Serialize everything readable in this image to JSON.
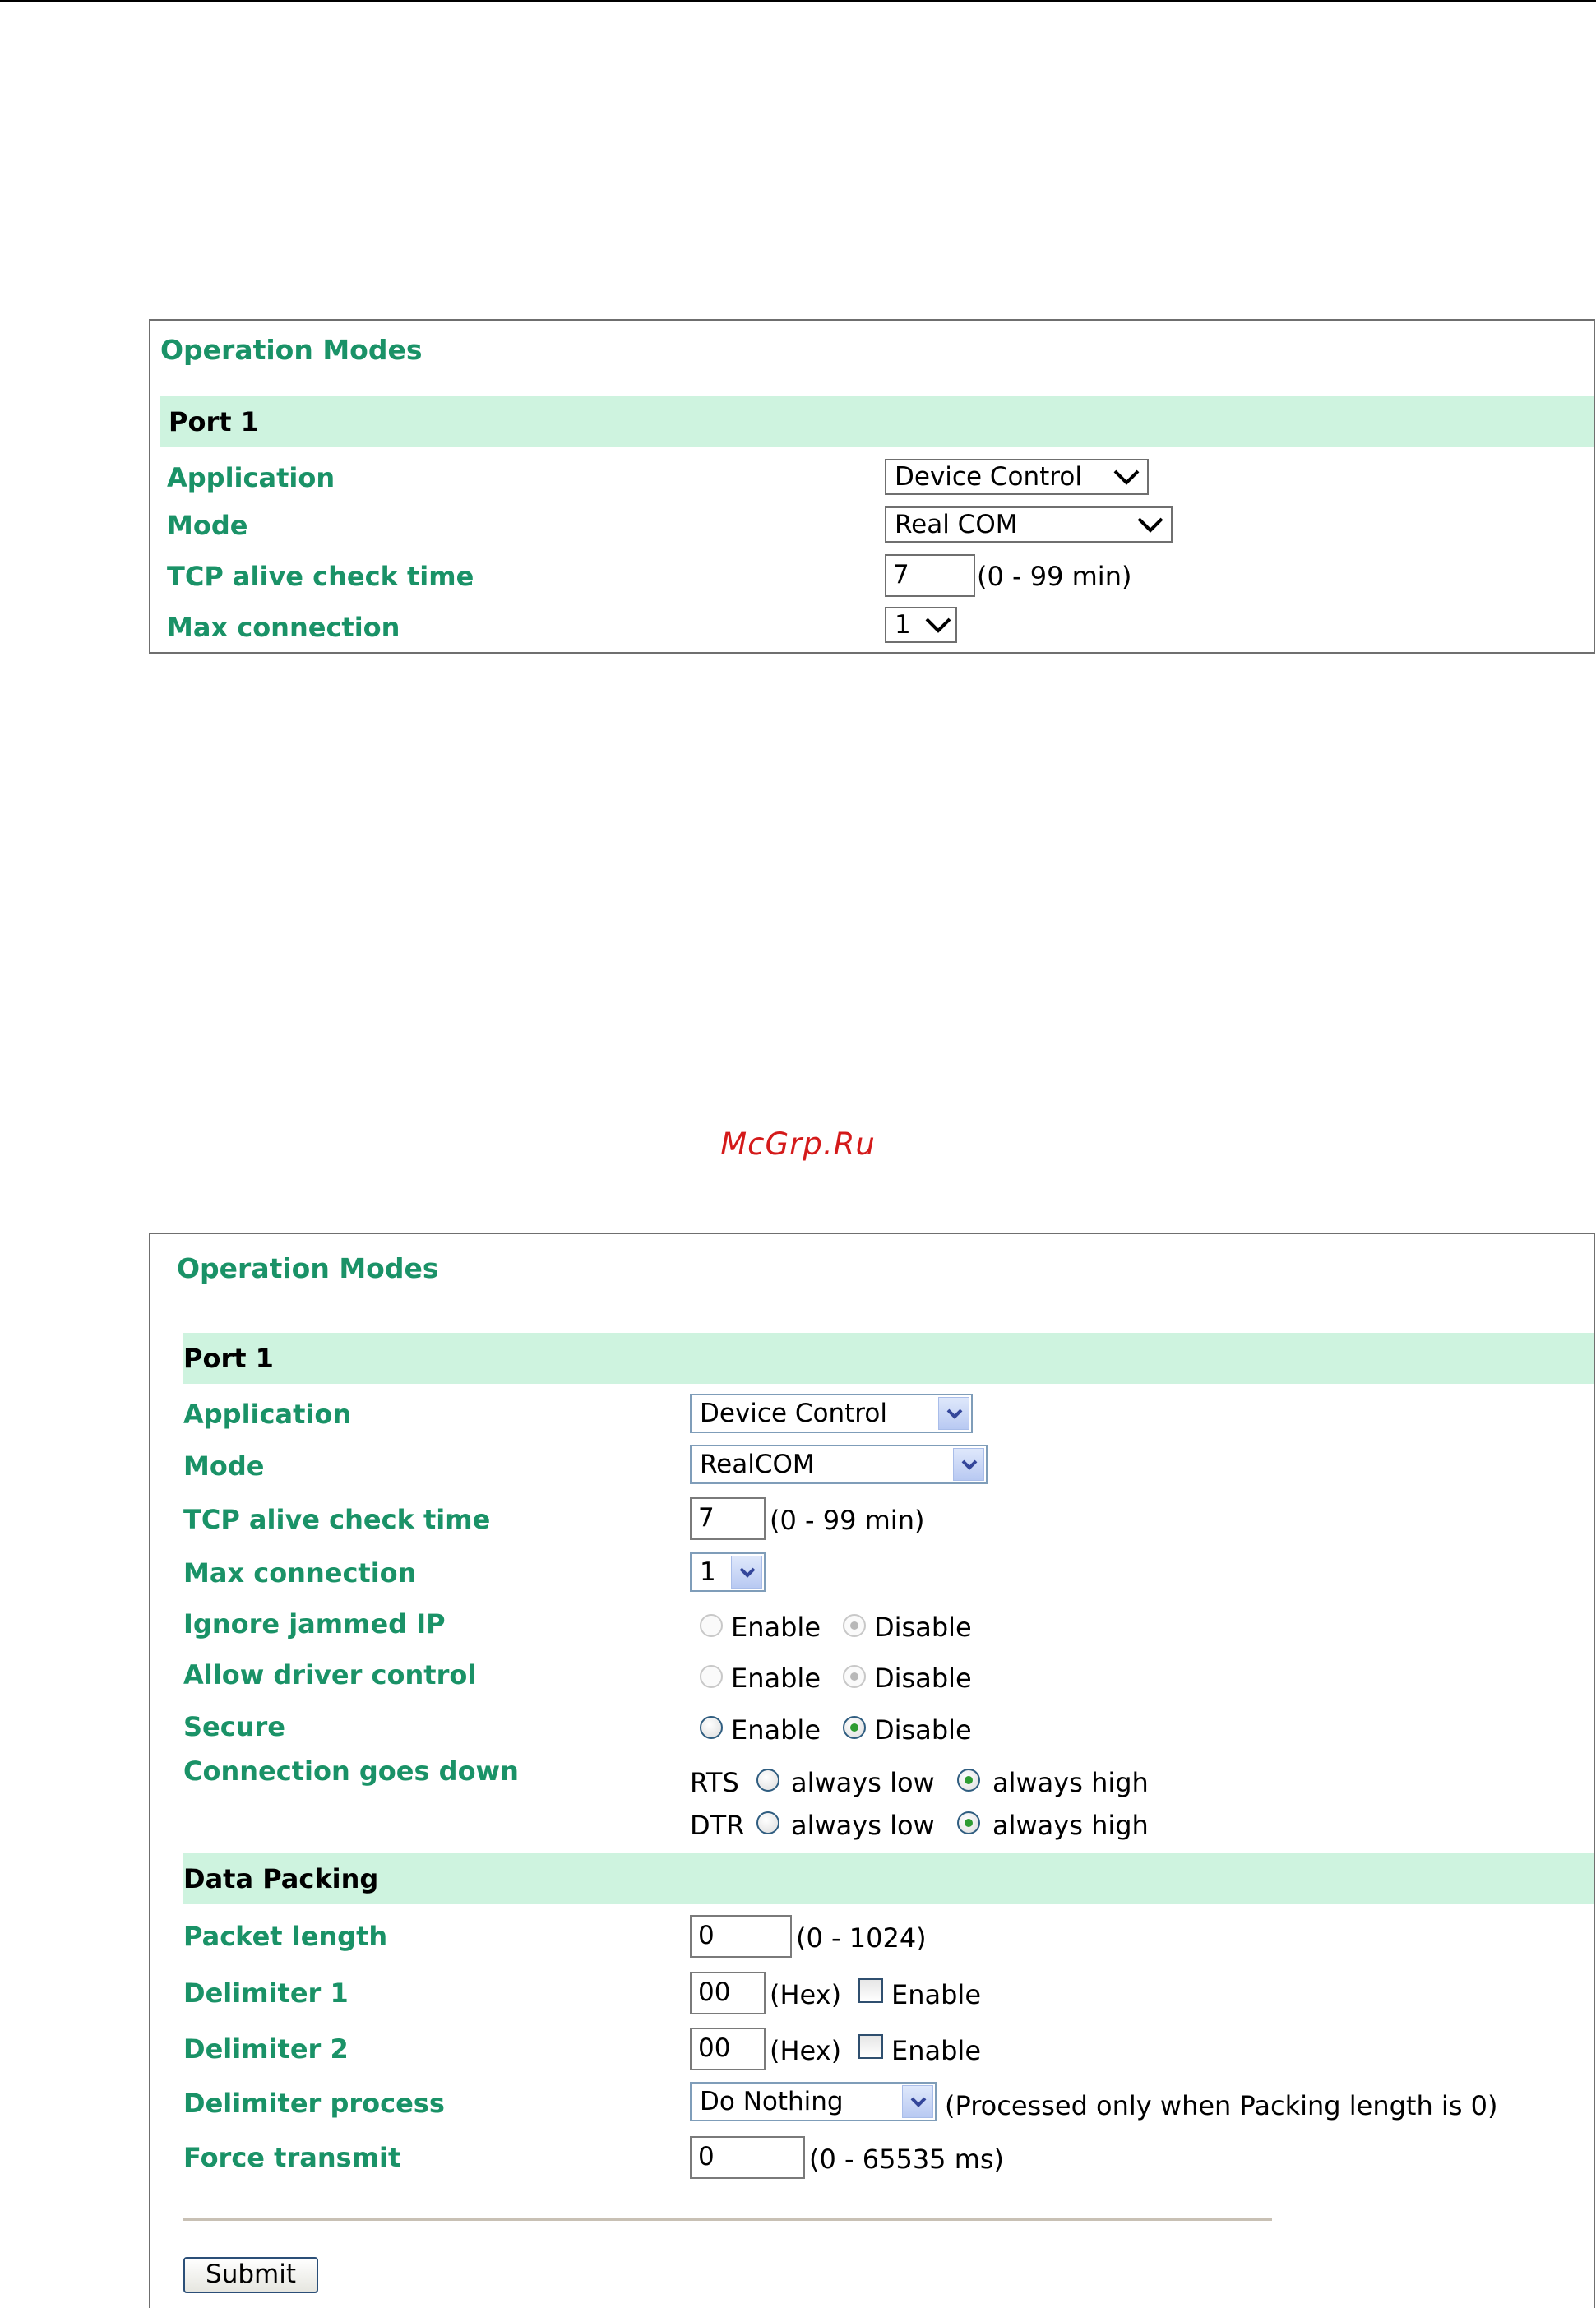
{
  "watermark": "McGrp.Ru",
  "panel1": {
    "title": "Operation Modes",
    "section": "Port 1",
    "rows": {
      "application_label": "Application",
      "application_value": "Device Control",
      "mode_label": "Mode",
      "mode_value": "Real COM",
      "tcp_label": "TCP alive check time",
      "tcp_value": "7",
      "tcp_range": "(0 - 99 min)",
      "maxconn_label": "Max connection",
      "maxconn_value": "1"
    }
  },
  "panel2": {
    "title": "Operation Modes",
    "section_port": "Port 1",
    "application_label": "Application",
    "application_value": "Device Control",
    "mode_label": "Mode",
    "mode_value": "RealCOM",
    "tcp_label": "TCP alive check time",
    "tcp_value": "7",
    "tcp_range": "(0 - 99 min)",
    "maxconn_label": "Max connection",
    "maxconn_value": "1",
    "ignore_label": "Ignore jammed IP",
    "allow_label": "Allow driver control",
    "secure_label": "Secure",
    "enable": "Enable",
    "disable": "Disable",
    "conn_label": "Connection goes down",
    "rts": "RTS",
    "dtr": "DTR",
    "always_low": "always low",
    "always_high": "always high",
    "section_packing": "Data Packing",
    "packet_label": "Packet length",
    "packet_value": "0",
    "packet_range": "(0 - 1024)",
    "delim1_label": "Delimiter 1",
    "delim1_value": "00",
    "delim2_label": "Delimiter 2",
    "delim2_value": "00",
    "hex": "(Hex)",
    "delimproc_label": "Delimiter process",
    "delimproc_value": "Do Nothing",
    "delimproc_note": "(Processed only when Packing length is 0)",
    "force_label": "Force transmit",
    "force_value": "0",
    "force_range": "(0 - 65535 ms)",
    "submit": "Submit"
  },
  "colors": {
    "label_green": "#1a9267",
    "section_bg": "#cef3df",
    "watermark_red": "#d41a1a"
  }
}
